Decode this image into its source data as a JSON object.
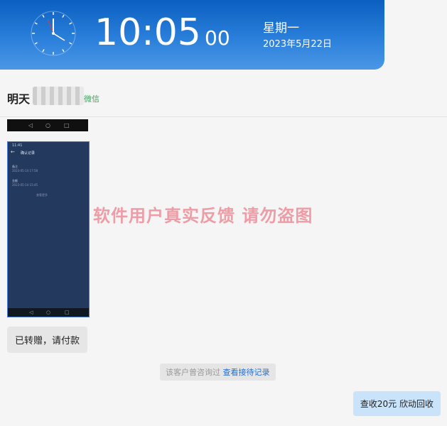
{
  "status_bar": {
    "time_hm": "10:05",
    "time_seconds": "00",
    "weekday": "星期一",
    "date": "2023年5月22日"
  },
  "chat": {
    "contact_name": "明天",
    "channel_label": "微信",
    "phone_screenshot": {
      "status": "11:41",
      "title": "确认记录",
      "rows": [
        {
          "label": "备注",
          "sub": "2023-05-14 17:58"
        },
        {
          "label": "金额",
          "sub": "2023-05-14 15:45"
        }
      ],
      "center_text": "查看更多"
    },
    "watermark": "软件用户真实反馈  请勿盗图",
    "message_left": "已转赠，请付款",
    "notice_prefix": "该客户曾咨询过 ",
    "notice_link": "查看接待记录",
    "message_right": "查收20元 欣动回收"
  }
}
